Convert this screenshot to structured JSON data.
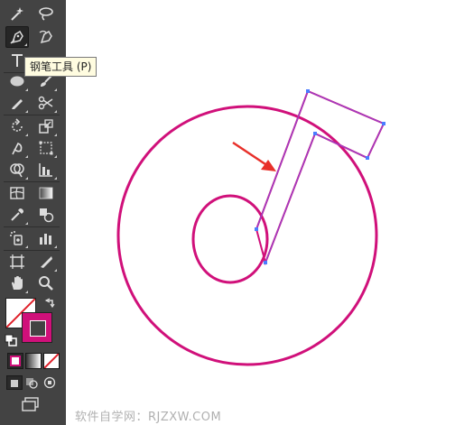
{
  "tooltip": {
    "text": "钢笔工具 (P)"
  },
  "footer": {
    "watermark": "软件自学网：RJZXW.COM"
  },
  "colors": {
    "toolbar_bg": "#434343",
    "stroke_magenta": "#d0107a",
    "path_purple": "#9b3fc8",
    "anchor_blue": "#4a7cff",
    "arrow_red": "#e8302a"
  },
  "tools": [
    "magic-wand-icon",
    "lasso-icon",
    "pen-icon",
    "curvature-pen-icon",
    "type-icon",
    "line-segment-icon",
    "ellipse-icon",
    "paintbrush-icon",
    "pencil-icon",
    "scissors-icon",
    "rotate-icon",
    "scale-icon",
    "warp-icon",
    "free-transform-icon",
    "shape-builder-icon",
    "graph-icon",
    "mesh-icon",
    "gradient-icon",
    "eyedropper-icon",
    "blend-icon",
    "symbol-sprayer-icon",
    "column-graph-icon",
    "artboard-icon",
    "slice-icon",
    "hand-icon",
    "zoom-icon"
  ]
}
